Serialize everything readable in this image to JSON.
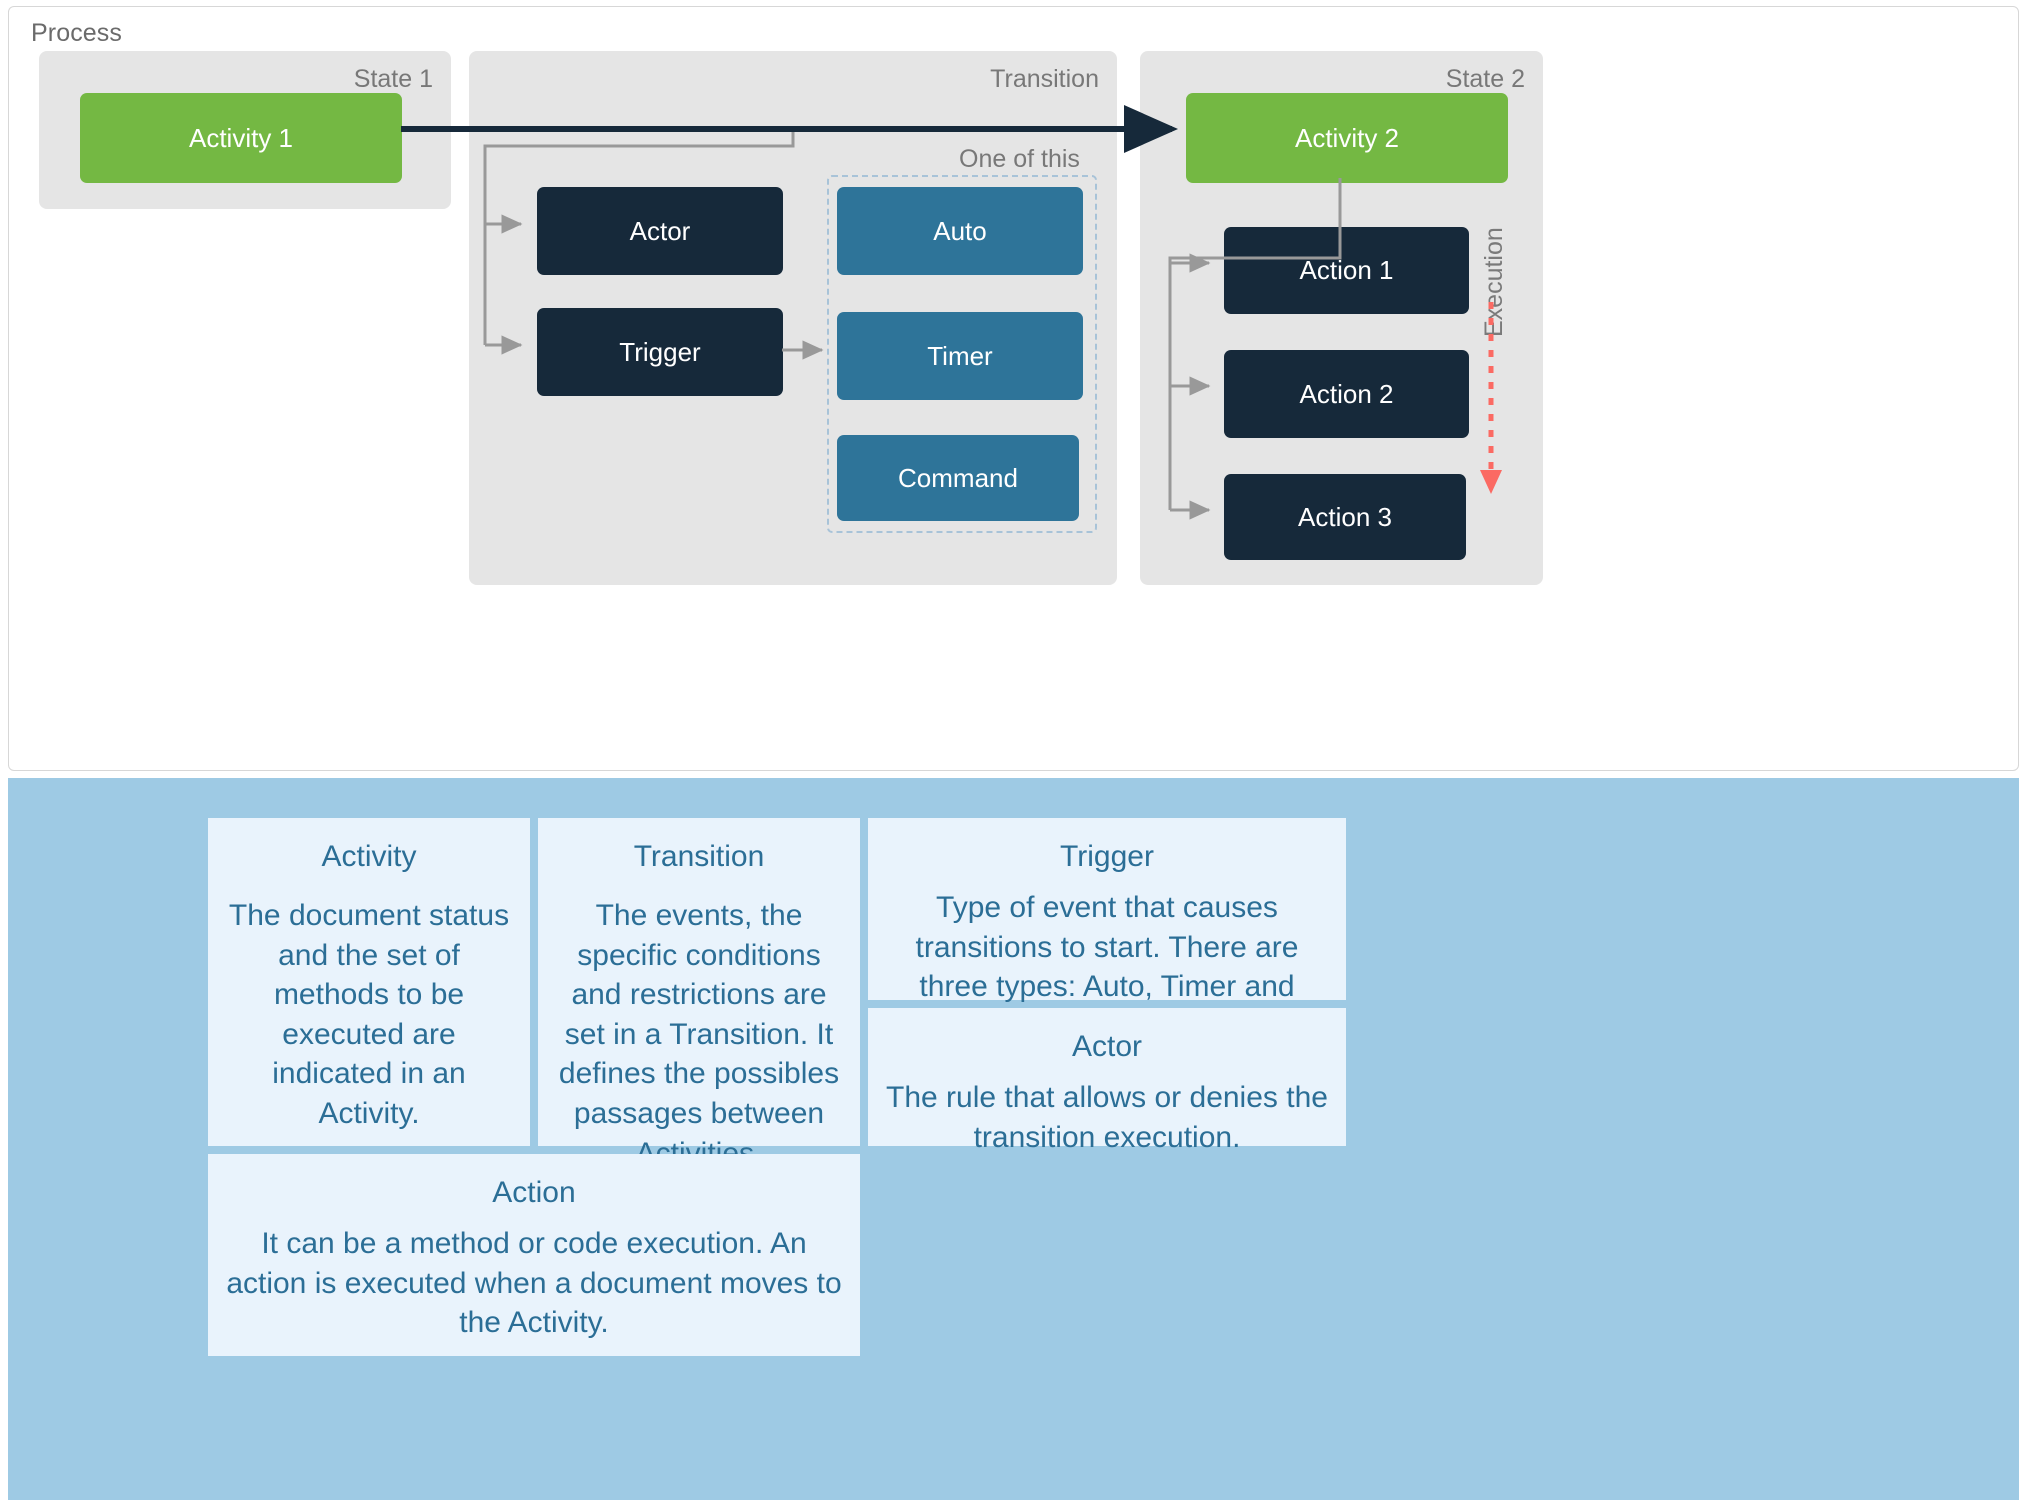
{
  "process": {
    "title": "Process",
    "lanes": [
      {
        "id": "state1",
        "title": "State 1"
      },
      {
        "id": "transition",
        "title": "Transition"
      },
      {
        "id": "state2",
        "title": "State 2"
      }
    ],
    "nodes": {
      "activity1": "Activity 1",
      "activity2": "Activity 2",
      "actor": "Actor",
      "trigger": "Trigger",
      "auto": "Auto",
      "timer": "Timer",
      "command": "Command",
      "action1": "Action 1",
      "action2": "Action 2",
      "action3": "Action 3"
    },
    "group_label": "One of this",
    "execution_label": "Execution"
  },
  "legend": {
    "cards": [
      {
        "title": "Activity",
        "body": "The document status and the set of methods to be executed are indicated in an Activity."
      },
      {
        "title": "Transition",
        "body": "The events, the specific conditions and restrictions are set in a Transition. It defines the possibles passages between Activities."
      },
      {
        "title": "Trigger",
        "body": "Type of event that causes transitions to start. There are three types: Auto, Timer and Command."
      },
      {
        "title": "Actor",
        "body": "The rule that allows or denies the transition execution."
      },
      {
        "title": "Action",
        "body": "It can be a method or code execution. An action is executed when a document moves to the Activity."
      }
    ]
  },
  "colors": {
    "activity_green": "#74b843",
    "node_dark": "#16293a",
    "trigger_blue": "#2e7499",
    "lane_gray": "#e5e5e5",
    "legend_bg": "#9ecae4",
    "card_bg": "#e9f3fc",
    "card_text": "#2b6e96",
    "main_arrow": "#16293a",
    "connector_gray": "#999999",
    "execution_red": "#fb6a63",
    "dashed_group": "#a8c3d8"
  }
}
